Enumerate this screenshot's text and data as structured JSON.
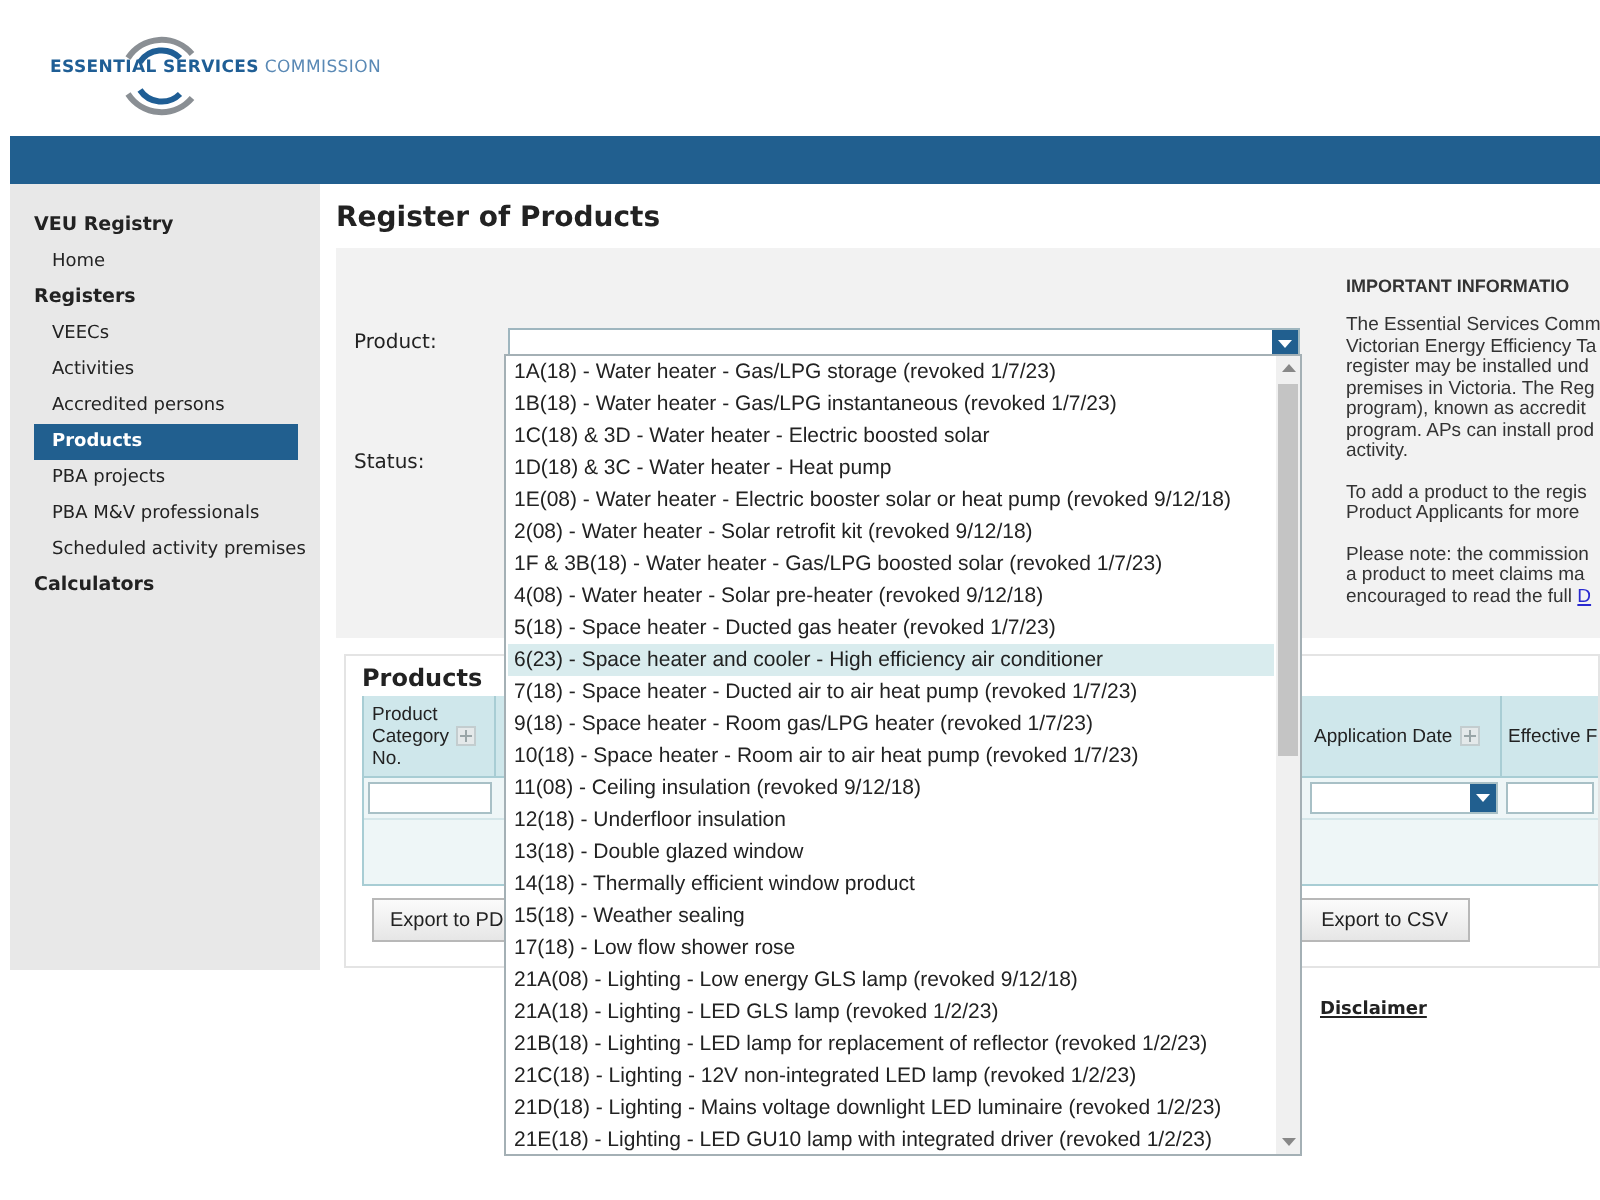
{
  "header": {
    "logo_bold": "ESSENTIAL SERVICES",
    "logo_light": "COMMISSION"
  },
  "sidebar": {
    "sections": [
      {
        "title": "VEU Registry",
        "items": [
          {
            "label": "Home",
            "selected": false
          }
        ]
      },
      {
        "title": "Registers",
        "items": [
          {
            "label": "VEECs",
            "selected": false
          },
          {
            "label": "Activities",
            "selected": false
          },
          {
            "label": "Accredited persons",
            "selected": false
          },
          {
            "label": "Products",
            "selected": true
          },
          {
            "label": "PBA projects",
            "selected": false
          },
          {
            "label": "PBA M&V professionals",
            "selected": false
          },
          {
            "label": "Scheduled activity premises",
            "selected": false
          }
        ]
      },
      {
        "title": "Calculators"
      }
    ]
  },
  "page_title": "Register of Products",
  "form": {
    "product_label": "Product:",
    "status_label": "Status:",
    "product_combobox": {
      "expanded": true,
      "options": [
        {
          "label": "1A(18) - Water heater - Gas/LPG storage (revoked 1/7/23)",
          "selected": false
        },
        {
          "label": "1B(18) - Water heater - Gas/LPG instantaneous (revoked 1/7/23)",
          "selected": false
        },
        {
          "label": "1C(18) & 3D - Water heater - Electric boosted solar",
          "selected": false
        },
        {
          "label": "1D(18) & 3C - Water heater - Heat pump",
          "selected": false
        },
        {
          "label": "1E(08) - Water heater - Electric booster solar or heat pump (revoked 9/12/18)",
          "selected": false
        },
        {
          "label": "2(08) - Water heater - Solar retrofit kit (revoked 9/12/18)",
          "selected": false
        },
        {
          "label": "1F & 3B(18) - Water heater - Gas/LPG boosted solar (revoked 1/7/23)",
          "selected": false
        },
        {
          "label": "4(08) - Water heater - Solar pre-heater (revoked 9/12/18)",
          "selected": false
        },
        {
          "label": "5(18) - Space heater - Ducted gas heater (revoked 1/7/23)",
          "selected": false
        },
        {
          "label": "6(23) - Space heater and cooler - High efficiency air conditioner",
          "selected": true
        },
        {
          "label": "7(18) - Space heater - Ducted air to air heat pump (revoked 1/7/23)",
          "selected": false
        },
        {
          "label": "9(18) - Space heater - Room gas/LPG heater (revoked 1/7/23)",
          "selected": false
        },
        {
          "label": "10(18) - Space heater - Room air to air heat pump (revoked 1/7/23)",
          "selected": false
        },
        {
          "label": "11(08) - Ceiling insulation (revoked 9/12/18)",
          "selected": false
        },
        {
          "label": "12(18) - Underfloor insulation",
          "selected": false
        },
        {
          "label": "13(18) - Double glazed window",
          "selected": false
        },
        {
          "label": "14(18) - Thermally efficient window product",
          "selected": false
        },
        {
          "label": "15(18) - Weather sealing",
          "selected": false
        },
        {
          "label": "17(18) - Low flow shower rose",
          "selected": false
        },
        {
          "label": "21A(08) - Lighting - Low energy GLS lamp (revoked 9/12/18)",
          "selected": false
        },
        {
          "label": "21A(18) - Lighting - LED GLS lamp (revoked 1/2/23)",
          "selected": false
        },
        {
          "label": "21B(18) - Lighting - LED lamp for replacement of reflector (revoked 1/2/23)",
          "selected": false
        },
        {
          "label": "21C(18) - Lighting - 12V non-integrated LED lamp (revoked 1/2/23)",
          "selected": false
        },
        {
          "label": "21D(18) - Lighting - Mains voltage downlight LED luminaire (revoked 1/2/23)",
          "selected": false
        },
        {
          "label": "21E(18) - Lighting - LED GU10 lamp with integrated driver (revoked 1/2/23)",
          "selected": false
        }
      ]
    }
  },
  "info": {
    "title": "IMPORTANT INFORMATIO",
    "paragraphs": [
      {
        "lines": [
          "The Essential Services Comm",
          "Victorian Energy Efficiency Ta",
          "register may be installed und",
          "premises in Victoria. The Reg",
          "program), known as accredit",
          "program. APs can install prod",
          "activity."
        ]
      },
      {
        "lines": [
          "To add a product to the regis",
          "Product Applicants for more"
        ]
      },
      {
        "lines": [
          "Please note: the commission",
          "a product to meet claims ma",
          "encouraged to read the full"
        ],
        "link": "D"
      }
    ]
  },
  "products": {
    "title": "Products",
    "columns": [
      {
        "label": "Product Category No.",
        "kind": "text"
      },
      {
        "label": "Application Date",
        "kind": "dropdown"
      },
      {
        "label": "Effective F",
        "kind": "text"
      }
    ],
    "buttons": [
      "Export to PD",
      "Export to CSV"
    ]
  },
  "disclaimer": "Disclaimer"
}
